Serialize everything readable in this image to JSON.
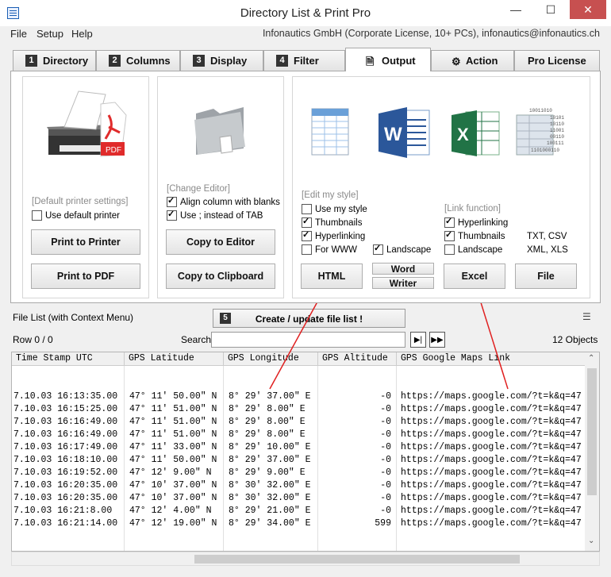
{
  "window": {
    "title": "Directory List & Print Pro",
    "minimize": "—",
    "maximize": "☐",
    "close": "✕"
  },
  "menu": {
    "items": [
      "File",
      "Setup",
      "Help"
    ],
    "license": "Infonautics GmbH (Corporate License, 10+ PCs), infonautics@infonautics.ch"
  },
  "tabs": [
    {
      "num": "1",
      "label": "Directory"
    },
    {
      "num": "2",
      "label": "Columns"
    },
    {
      "num": "3",
      "label": "Display"
    },
    {
      "num": "4",
      "label": "Filter"
    },
    {
      "num": "",
      "label": "Output"
    },
    {
      "num": "",
      "label": "Action"
    },
    {
      "num": "",
      "label": "Pro License"
    }
  ],
  "printer": {
    "settings_link": "[Default printer settings]",
    "use_default": "Use default printer",
    "use_default_checked": false,
    "print_btn": "Print to Printer",
    "pdf_btn": "Print to PDF",
    "pdf_icon_text": "PDF"
  },
  "editor": {
    "change_link": "[Change Editor]",
    "align": "Align column with blanks",
    "align_checked": true,
    "use_semicolon": "Use  ;  instead of TAB",
    "use_semicolon_checked": true,
    "copy_editor": "Copy to Editor",
    "copy_clipboard": "Copy to Clipboard"
  },
  "output": {
    "edit_style": "[Edit my style]",
    "use_my_style": "Use my style",
    "use_my_style_checked": false,
    "thumbnails": "Thumbnails",
    "thumbnails_checked": true,
    "hyperlinking": "Hyperlinking",
    "hyperlinking_checked": true,
    "for_www": "For WWW",
    "for_www_checked": false,
    "landscape": "Landscape",
    "landscape_checked": true,
    "html_btn": "HTML",
    "word_btn": "Word",
    "writer_btn": "Writer",
    "link_function": "[Link function]",
    "x_hyperlinking": "Hyperlinking",
    "x_hyperlinking_checked": true,
    "x_thumbnails": "Thumbnails",
    "x_thumbnails_checked": true,
    "x_landscape": "Landscape",
    "x_landscape_checked": false,
    "excel_btn": "Excel",
    "txt_csv": "TXT, CSV",
    "xml_xls": "XML, XLS",
    "file_btn": "File",
    "word_icon_text": "W",
    "excel_icon_text": "X",
    "binary_text": [
      "10011010",
      "10101",
      "10110",
      "11001",
      "00110",
      "100111",
      "1101000110"
    ]
  },
  "filelist": {
    "label": "File List (with Context Menu)",
    "create_num": "5",
    "create_btn": "Create / update file list !",
    "row_info": "Row 0 / 0",
    "search_label": "Search",
    "objects": "12 Objects",
    "columns": [
      "Time Stamp UTC",
      "GPS Latitude",
      "GPS Longitude",
      "GPS Altitude",
      "GPS Google Maps Link"
    ],
    "rows": [
      [
        "7.10.03 16:13:35.00",
        "47° 11' 50.00\" N",
        "8° 29' 37.00\" E",
        "-0",
        "https://maps.google.com/?t=k&q=47"
      ],
      [
        "7.10.03 16:15:25.00",
        "47° 11' 51.00\" N",
        "8° 29' 8.00\" E",
        "-0",
        "https://maps.google.com/?t=k&q=47"
      ],
      [
        "7.10.03 16:16:49.00",
        "47° 11' 51.00\" N",
        "8° 29' 8.00\" E",
        "-0",
        "https://maps.google.com/?t=k&q=47"
      ],
      [
        "7.10.03 16:16:49.00",
        "47° 11' 51.00\" N",
        "8° 29' 8.00\" E",
        "-0",
        "https://maps.google.com/?t=k&q=47"
      ],
      [
        "7.10.03 16:17:49.00",
        "47° 11' 33.00\" N",
        "8° 29' 10.00\" E",
        "-0",
        "https://maps.google.com/?t=k&q=47"
      ],
      [
        "7.10.03 16:18:10.00",
        "47° 11' 50.00\" N",
        "8° 29' 37.00\" E",
        "-0",
        "https://maps.google.com/?t=k&q=47"
      ],
      [
        "7.10.03 16:19:52.00",
        "47° 12' 9.00\" N",
        "8° 29' 9.00\" E",
        "-0",
        "https://maps.google.com/?t=k&q=47"
      ],
      [
        "7.10.03 16:20:35.00",
        "47° 10' 37.00\" N",
        "8° 30' 32.00\" E",
        "-0",
        "https://maps.google.com/?t=k&q=47"
      ],
      [
        "7.10.03 16:20:35.00",
        "47° 10' 37.00\" N",
        "8° 30' 32.00\" E",
        "-0",
        "https://maps.google.com/?t=k&q=47"
      ],
      [
        "7.10.03 16:21:8.00",
        "47° 12' 4.00\" N",
        "8° 29' 21.00\" E",
        "-0",
        "https://maps.google.com/?t=k&q=47"
      ],
      [
        "7.10.03 16:21:14.00",
        "47° 12' 19.00\" N",
        "8° 29' 34.00\" E",
        "599",
        "https://maps.google.com/?t=k&q=47"
      ]
    ]
  },
  "colors": {
    "close_red": "#c75050",
    "arrow_red": "#e02020",
    "pdf_red": "#e02b2b",
    "word_blue": "#2b579a",
    "excel_green": "#217346"
  }
}
